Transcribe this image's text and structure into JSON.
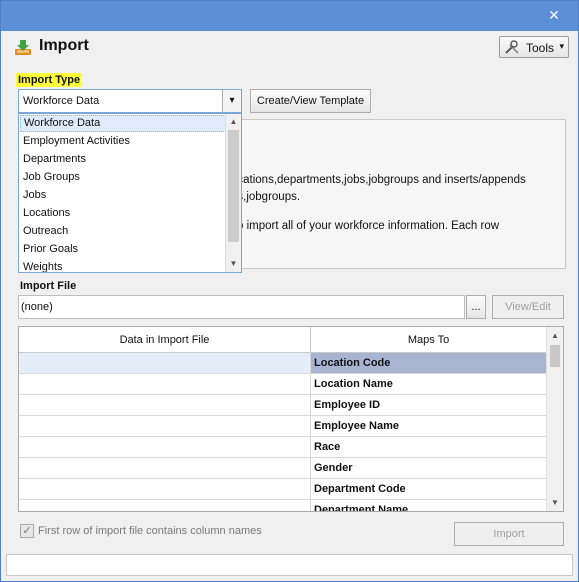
{
  "window": {
    "close_glyph": "✕"
  },
  "header": {
    "title": "Import",
    "tools_label": "Tools",
    "tools_arrow": "▾",
    "icon": "download-tray-icon"
  },
  "import_type": {
    "label": "Import Type",
    "selected": "Workforce Data",
    "combo_arrow": "▾",
    "create_template_label": "Create/View Template",
    "options": [
      "Workforce Data",
      "Employment Activities",
      "Departments",
      "Job Groups",
      "Jobs",
      "Locations",
      "Outreach",
      "Prior Goals",
      "Weights"
    ]
  },
  "description": {
    "lines": [
      "ocations,departments,jobs,jobgroups and inserts/appends",
      "bs,jobgroups.",
      "o import all of your workforce information. Each row"
    ]
  },
  "import_file": {
    "label": "Import File",
    "value": "(none)",
    "browse_label": "...",
    "view_edit_label": "View/Edit"
  },
  "grid": {
    "headers": [
      "Data in Import File",
      "Maps To"
    ],
    "rows": [
      {
        "source": "",
        "maps_to": "Location Code"
      },
      {
        "source": "",
        "maps_to": "Location Name"
      },
      {
        "source": "",
        "maps_to": "Employee ID"
      },
      {
        "source": "",
        "maps_to": "Employee Name"
      },
      {
        "source": "",
        "maps_to": "Race"
      },
      {
        "source": "",
        "maps_to": "Gender"
      },
      {
        "source": "",
        "maps_to": "Department Code"
      },
      {
        "source": "",
        "maps_to": "Department Name"
      }
    ],
    "scroll_up": "▲",
    "scroll_down": "▼"
  },
  "footer": {
    "checkbox_label": "First row of import file contains column names",
    "checkbox_checked": true,
    "check_glyph": "✓",
    "import_label": "Import"
  },
  "colors": {
    "titlebar": "#5b8fd6",
    "highlight": "#ffff3a",
    "selected_row": "#a9b4d3"
  }
}
